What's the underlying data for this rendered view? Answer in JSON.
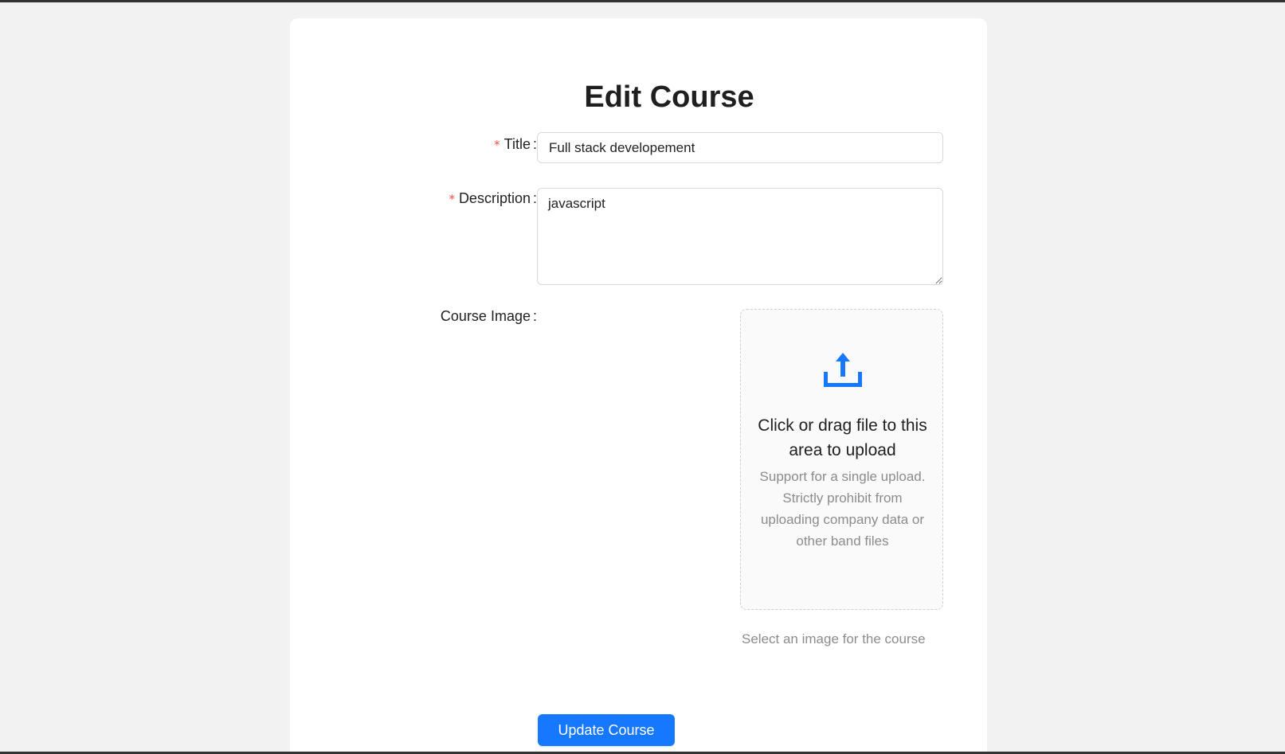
{
  "page": {
    "title": "Edit Course"
  },
  "form": {
    "title_field": {
      "required_mark": "*",
      "label": "Title",
      "colon": ":",
      "value": "Full stack developement"
    },
    "description_field": {
      "required_mark": "*",
      "label": "Description",
      "colon": ":",
      "value": "javascript"
    },
    "image_field": {
      "label": "Course Image",
      "colon": ":",
      "dropzone_title": "Click or drag file to this area to upload",
      "dropzone_hint": "Support for a single upload. Strictly prohibit from uploading company data or other band files",
      "help_text": "Select an image for the course",
      "icon": "upload-icon"
    },
    "submit_label": "Update Course"
  },
  "colors": {
    "accent": "#1677ff",
    "required": "#ff4d4f",
    "muted_text": "#8c8c8c"
  }
}
